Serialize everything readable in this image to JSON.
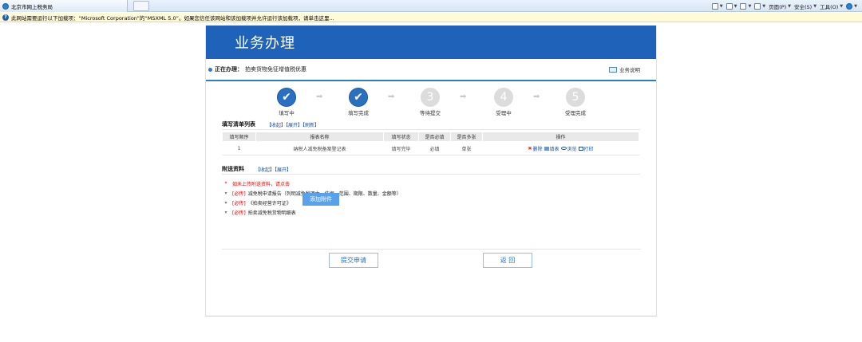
{
  "browser": {
    "tab_title": "北京市网上税务局",
    "menus": [
      {
        "name": "home-menu",
        "label": ""
      },
      {
        "name": "feeds-menu",
        "label": ""
      },
      {
        "name": "mail-menu",
        "label": ""
      },
      {
        "name": "print-menu",
        "label": ""
      },
      {
        "name": "page-menu",
        "label": "页面(P)"
      },
      {
        "name": "safety-menu",
        "label": "安全(S)"
      },
      {
        "name": "tools-menu",
        "label": "工具(O)"
      },
      {
        "name": "help-menu",
        "label": ""
      }
    ],
    "infobar_text": "此网站需要运行以下加载项：“Microsoft Corporation”的“MSXML 5.0”。如果您信任该网站和该加载项并允许运行该加载项，请单击这里..."
  },
  "banner": {
    "title": "业务办理"
  },
  "current": {
    "label": "正在办理：",
    "value": "拍卖货物免征增值税优惠",
    "help_link": "业务说明"
  },
  "steps": [
    {
      "label": "填写中",
      "number": "",
      "done": true
    },
    {
      "label": "填写完成",
      "number": "",
      "done": true
    },
    {
      "label": "等待提交",
      "number": "3",
      "done": false
    },
    {
      "label": "受理中",
      "number": "4",
      "done": false
    },
    {
      "label": "受理完成",
      "number": "5",
      "done": false
    }
  ],
  "fill_list": {
    "title": "填写清单列表",
    "links": "【收起】【展开】【刷新】",
    "columns": [
      "填写顺序",
      "报表名称",
      "填写状态",
      "是否必填",
      "是否多张",
      "操作"
    ],
    "rows": [
      {
        "order": "1",
        "name": "纳税人减免税备案登记表",
        "status": "填写完毕",
        "required": "必填",
        "multi": "单张"
      }
    ],
    "ops": {
      "delete": "删除",
      "fill": "填表",
      "view": "浏览",
      "print": "打印"
    }
  },
  "attachments": {
    "title": "附送资料",
    "links": "【收起】【展开】",
    "notice": "如未上传附送资料，请点击",
    "add_button": "添加附件",
    "items": [
      {
        "tag": "[必传]",
        "text": "减免税申请报告（列明减免税理由、依据、范围、期限、数量、金额等）"
      },
      {
        "tag": "[必传]",
        "text": "《拍卖经营许可证》"
      },
      {
        "tag": "[必传]",
        "text": "拍卖减免税货物明细表"
      }
    ]
  },
  "buttons": {
    "submit": "提交申请",
    "back": "返  回"
  },
  "colors": {
    "brand": "#1e63b9",
    "accent": "#2c7cc8",
    "warning": "#e00000"
  }
}
